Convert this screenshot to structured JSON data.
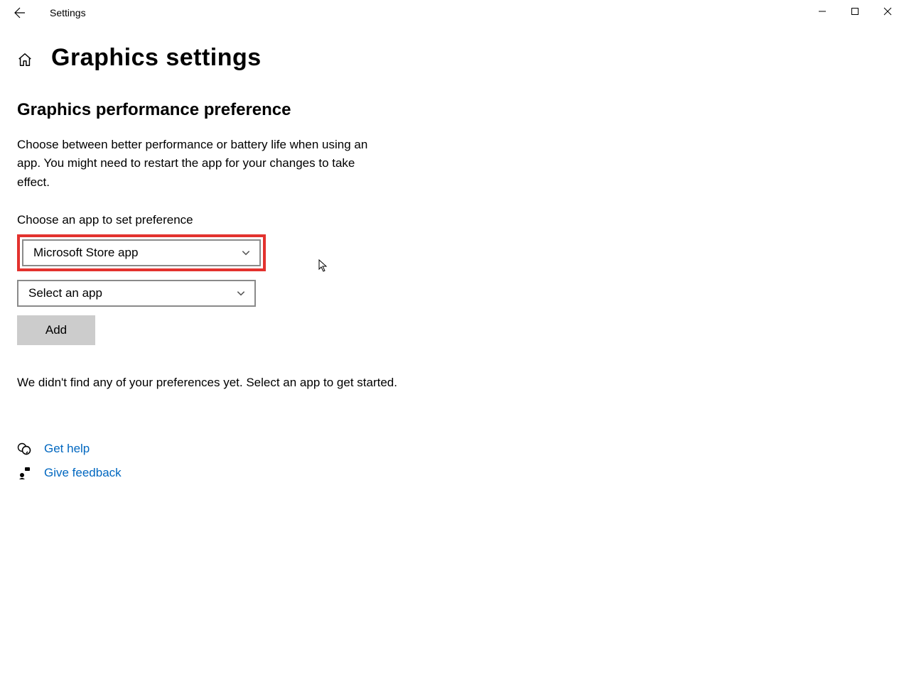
{
  "titlebar": {
    "title": "Settings"
  },
  "page": {
    "title": "Graphics settings"
  },
  "section": {
    "heading": "Graphics performance preference",
    "description": "Choose between better performance or battery life when using an app. You might need to restart the app for your changes to take effect.",
    "field_label": "Choose an app to set preference",
    "dropdown_app_type": "Microsoft Store app",
    "dropdown_select_app": "Select an app",
    "add_button": "Add",
    "empty_message": "We didn't find any of your preferences yet. Select an app to get started."
  },
  "links": {
    "get_help": "Get help",
    "give_feedback": "Give feedback"
  },
  "colors": {
    "highlight": "#e3322e",
    "link": "#0067c0",
    "button_bg": "#cccccc"
  }
}
